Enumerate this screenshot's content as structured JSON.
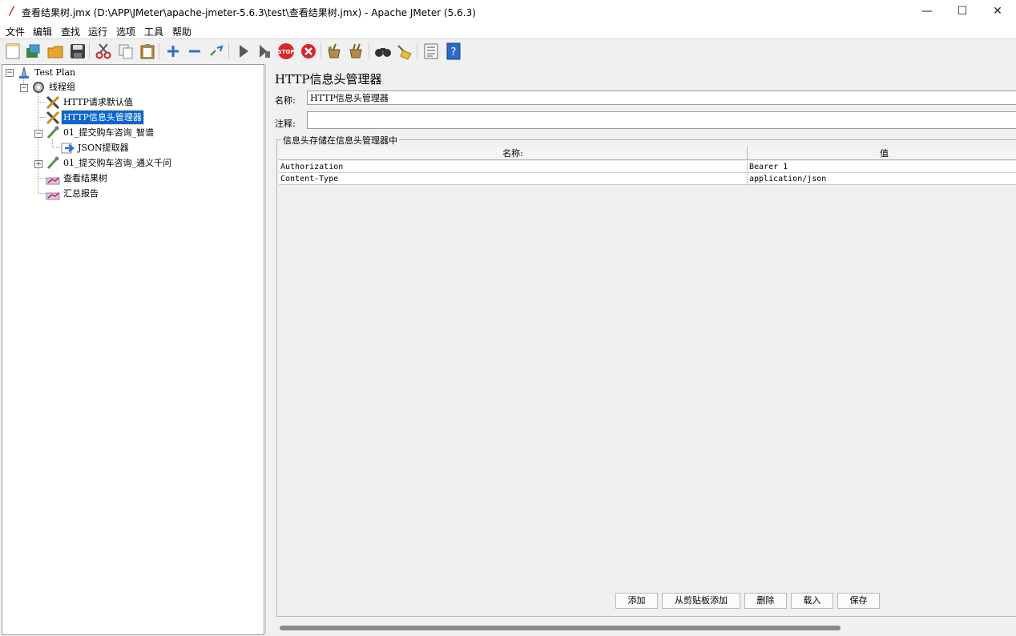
{
  "window": {
    "title": "查看结果树.jmx (D:\\APP\\JMeter\\apache-jmeter-5.6.3\\test\\查看结果树.jmx) - Apache JMeter (5.6.3)",
    "controls": {
      "minimize": "—",
      "maximize": "☐",
      "close": "✕"
    }
  },
  "menu": [
    "文件",
    "编辑",
    "查找",
    "运行",
    "选项",
    "工具",
    "帮助"
  ],
  "toolbar": {
    "icons": [
      "new-icon",
      "templates-icon",
      "open-icon",
      "save-icon",
      "cut-icon",
      "copy-icon",
      "paste-icon",
      "expand-icon",
      "collapse-icon",
      "toggle-icon",
      "start-icon",
      "start-no-pauses-icon",
      "stop-icon",
      "shutdown-icon",
      "clear-icon",
      "clear-all-icon",
      "search-icon",
      "reset-search-icon",
      "function-helper-icon",
      "help-icon"
    ]
  },
  "tree": {
    "nodes": [
      {
        "label": "Test Plan",
        "icon": "test-plan-icon"
      },
      {
        "label": "线程组",
        "icon": "thread-group-icon"
      },
      {
        "label": "HTTP请求默认值",
        "icon": "config-tools-icon"
      },
      {
        "label": "HTTP信息头管理器",
        "icon": "config-tools-icon",
        "selected": true
      },
      {
        "label": "01_提交购车咨询_智谱",
        "icon": "sampler-pipette-icon"
      },
      {
        "label": "JSON提取器",
        "icon": "post-processor-arrow-icon"
      },
      {
        "label": "01_提交购车咨询_通义千问",
        "icon": "sampler-pipette-icon"
      },
      {
        "label": "查看结果树",
        "icon": "listener-chart-icon"
      },
      {
        "label": "汇总报告",
        "icon": "listener-chart-icon"
      }
    ]
  },
  "editor": {
    "title": "HTTP信息头管理器",
    "name_label": "名称:",
    "name_value": "HTTP信息头管理器",
    "comment_label": "注释:",
    "comment_value": "",
    "group_title": "信息头存储在信息头管理器中",
    "columns": [
      "名称:",
      "值"
    ],
    "rows": [
      {
        "name": "Authorization",
        "value": "Bearer 1"
      },
      {
        "name": "Content-Type",
        "value": "application/json"
      }
    ],
    "buttons": {
      "add": "添加",
      "add_clipboard": "从剪贴板添加",
      "delete": "删除",
      "load": "载入",
      "save": "保存"
    }
  }
}
